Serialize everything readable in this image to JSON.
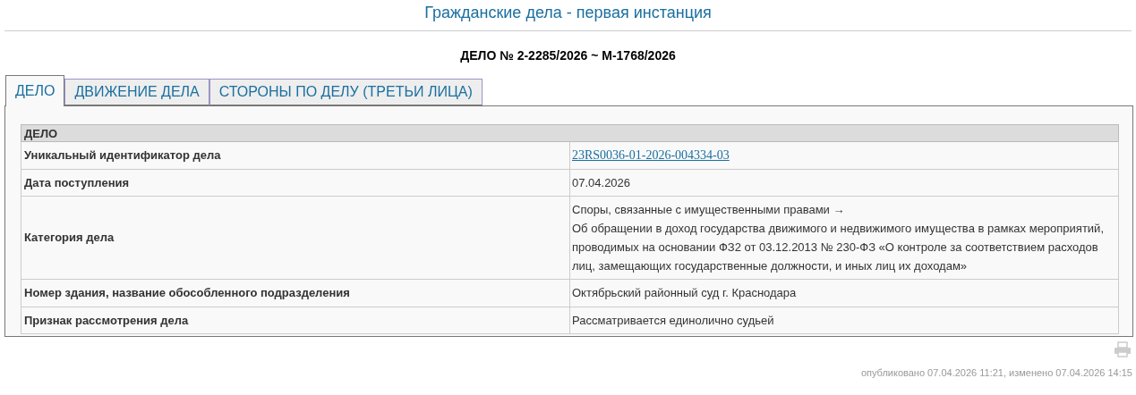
{
  "page_title": "Гражданские дела - первая инстанция",
  "case_title": "ДЕЛО № 2-2285/2026 ~ М-1768/2026",
  "tabs": [
    {
      "label": "ДЕЛО",
      "selected": true
    },
    {
      "label": "ДВИЖЕНИЕ ДЕЛА",
      "selected": false
    },
    {
      "label": "СТОРОНЫ ПО ДЕЛУ (ТРЕТЬИ ЛИЦА)",
      "selected": false
    }
  ],
  "table": {
    "header": "ДЕЛО",
    "rows": [
      {
        "label": "Уникальный идентификатор дела",
        "kind": "link",
        "value": [
          "23RS0036-01-2026-004334-03"
        ]
      },
      {
        "label": "Дата поступления",
        "kind": "text",
        "value": [
          "07.04.2026"
        ]
      },
      {
        "label": "Категория дела",
        "kind": "text",
        "value": [
          "Споры, связанные с имущественными правами →",
          "Об обращении в доход государства движимого и недвижимого имущества в рамках мероприятий, проводимых на основании ФЗ2 от 03.12.2013 № 230-ФЗ «О контроле за соответствием расходов лиц, замещающих государственные должности, и иных лиц их доходам»"
        ]
      },
      {
        "label": "Номер здания, название обособленного подразделения",
        "kind": "text",
        "value": [
          "Октябрьский районный суд г. Краснодара"
        ]
      },
      {
        "label": "Признак рассмотрения дела",
        "kind": "text",
        "value": [
          "Рассматривается единолично судьей"
        ]
      }
    ]
  },
  "footer": "опубликовано 07.04.2026 11:21, изменено 07.04.2026 14:15"
}
